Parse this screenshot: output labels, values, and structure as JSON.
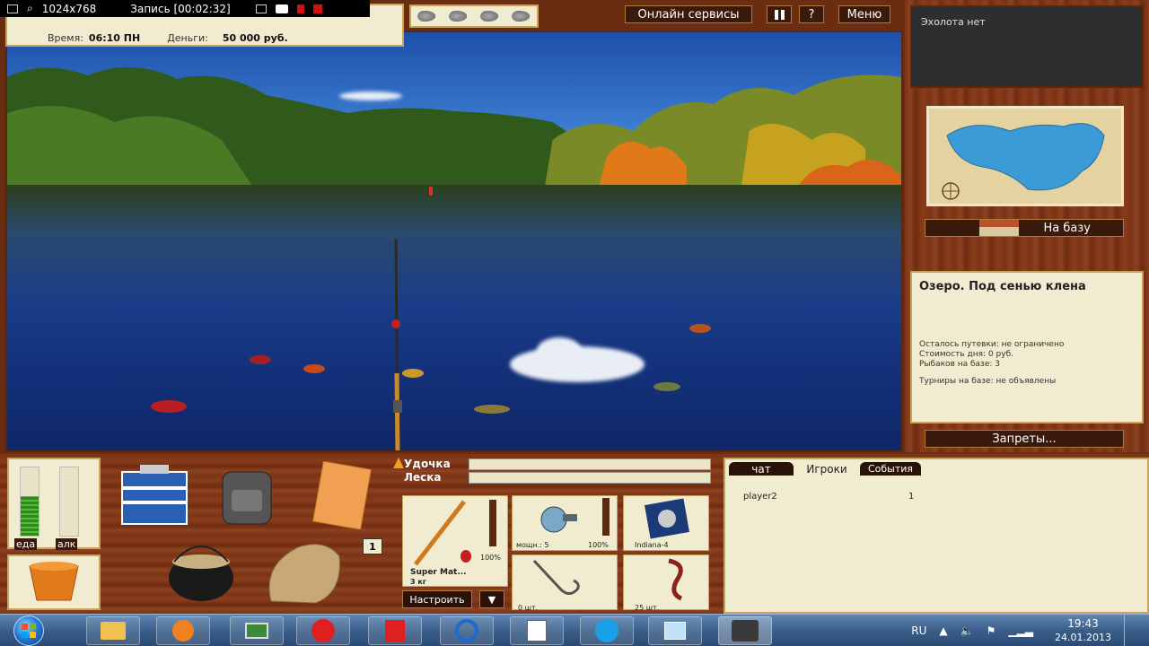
{
  "recorder": {
    "resolution": "1024x768",
    "recording": "Запись [00:02:32]"
  },
  "status": {
    "time_label": "Время:",
    "time_value": "06:10 ПН",
    "money_label": "Деньги:",
    "money_value": "50 000 руб."
  },
  "topbar": {
    "online_services": "Онлайн сервисы",
    "pause_icon": "pause-icon",
    "help": "?",
    "menu": "Меню"
  },
  "sidebar": {
    "echosounder": "Эхолота нет",
    "to_base": "На базу",
    "location_title": "Озеро. Под сенью клена",
    "trip_left": "Осталось путевки: не ограничено",
    "day_cost": "Стоимость дня: 0 руб.",
    "anglers": "Рыбаков на базе: 3",
    "tournaments": "Турниры на базе: не объявлены",
    "bans": "Запреты..."
  },
  "meters": {
    "food_label": "еда",
    "alcohol_label": "алк",
    "food_level": 0.58,
    "alcohol_level": 0.0
  },
  "inventory": {
    "badge": "1"
  },
  "tackle": {
    "rod_label": "Удочка",
    "line_label": "Леска",
    "rod_name": "Super Mat...",
    "rod_weight": "3 кг",
    "rod_condition": "100%",
    "reel_power": "мощн.: 5",
    "reel_condition": "100%",
    "line_name": "Indiana-4",
    "hook_count": "0 шт.",
    "bait_count": "25 шт.",
    "adjust": "Настроить",
    "dropdown": "▼"
  },
  "chat": {
    "tabs": [
      "чат",
      "Игроки",
      "События"
    ],
    "active_tab": "Игроки",
    "players": [
      {
        "name": "player2",
        "value": "1"
      }
    ]
  },
  "taskbar": {
    "language": "RU",
    "time": "19:43",
    "date": "24.01.2013",
    "apps": [
      "explorer",
      "media-player",
      "remote-desktop",
      "yandex-browser",
      "yandex",
      "mail-agent",
      "notepad",
      "skype",
      "window",
      "fishing-game"
    ]
  },
  "colors": {
    "wood": "#7a3417",
    "parchment": "#f1ebcf",
    "button_dark": "#3a1a0a",
    "taskbar": "#3b5f8a"
  }
}
